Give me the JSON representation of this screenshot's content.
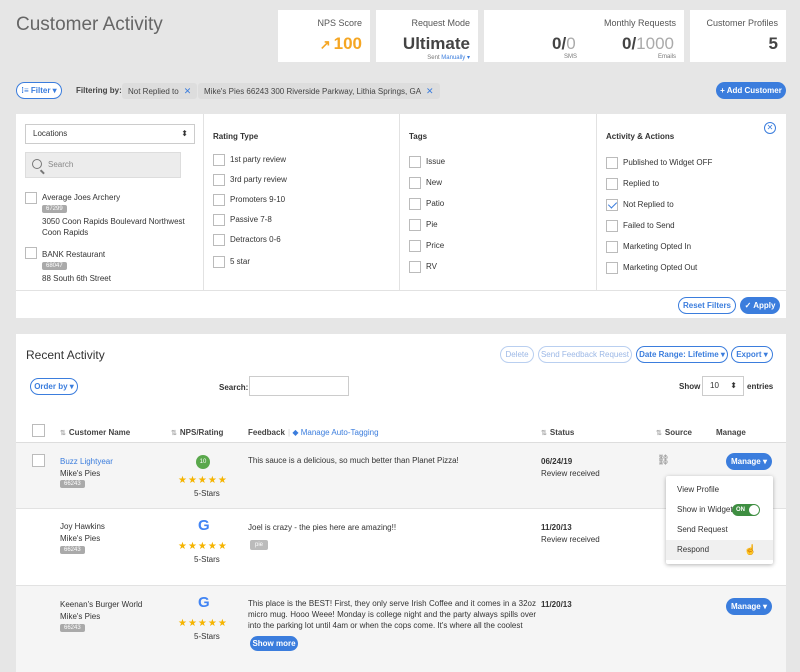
{
  "page_title": "Customer Activity",
  "stats": {
    "nps": {
      "label": "NPS Score",
      "value": "100"
    },
    "request_mode": {
      "label": "Request Mode",
      "value": "Ultimate",
      "sub_prefix": "Sent",
      "sub_link": "Manually"
    },
    "monthly": {
      "label": "Monthly Requests",
      "sms_value": "0/",
      "sms_limit": "0",
      "sms_label": "SMS",
      "email_value": "0/",
      "email_limit": "1000",
      "email_label": "Emails"
    },
    "profiles": {
      "label": "Customer Profiles",
      "value": "5"
    }
  },
  "filterbar": {
    "filter_btn": "Filter",
    "filtering_by": "Filtering by:",
    "chips": [
      "Not Replied to",
      "Mike's Pies 66243 300 Riverside Parkway, Lithia Springs, GA"
    ],
    "add_customer": "+ Add Customer"
  },
  "filters": {
    "locations_select": "Locations",
    "search_placeholder": "Search",
    "locations": [
      {
        "name": "Average Joes Archery",
        "id": "67299",
        "address": "3050 Coon Rapids Boulevard Northwest",
        "city": "Coon Rapids"
      },
      {
        "name": "BANK Restaurant",
        "id": "68047",
        "address": "88 South 6th Street",
        "city": ""
      }
    ],
    "rating_title": "Rating Type",
    "ratings": [
      "1st party review",
      "3rd party review",
      "Promoters 9-10",
      "Passive 7-8",
      "Detractors 0-6",
      "5 star"
    ],
    "tags_title": "Tags",
    "tags": [
      "Issue",
      "New",
      "Patio",
      "Pie",
      "Price",
      "RV"
    ],
    "activity_title": "Activity & Actions",
    "activities": [
      {
        "label": "Published to Widget OFF",
        "checked": false
      },
      {
        "label": "Replied to",
        "checked": false
      },
      {
        "label": "Not Replied to",
        "checked": true
      },
      {
        "label": "Failed to Send",
        "checked": false
      },
      {
        "label": "Marketing Opted In",
        "checked": false
      },
      {
        "label": "Marketing Opted Out",
        "checked": false
      }
    ],
    "reset": "Reset Filters",
    "apply": "Apply"
  },
  "recent": {
    "title": "Recent Activity",
    "delete": "Delete",
    "send_feedback": "Send Feedback Request",
    "date_range": "Date Range: Lifetime",
    "export": "Export",
    "order_by": "Order by",
    "search_label": "Search:",
    "show_label": "Show",
    "show_value": "10",
    "entries_label": "entries",
    "columns": {
      "name": "Customer Name",
      "nps": "NPS/Rating",
      "feedback": "Feedback",
      "auto_tag": "Manage Auto-Tagging",
      "status": "Status",
      "source": "Source",
      "manage": "Manage"
    },
    "rows": [
      {
        "name": "Buzz Lightyear",
        "location": "Mike's Pies",
        "loc_id": "66243",
        "nps": "10",
        "stars_label": "5-Stars",
        "feedback": "This sauce is a delicious, so much better than Planet Pizza!",
        "date": "06/24/19",
        "status": "Review received",
        "manage": "Manage"
      },
      {
        "name": "Joy Hawkins",
        "location": "Mike's Pies",
        "loc_id": "66243",
        "nps": "",
        "stars_label": "5-Stars",
        "feedback": "Joel is crazy - the pies here are amazing!!",
        "tag": "pie",
        "date": "11/20/13",
        "status": "Review received",
        "manage": ""
      },
      {
        "name": "Keenan's Burger World",
        "location": "Mike's Pies",
        "loc_id": "66243",
        "nps": "",
        "stars_label": "5-Stars",
        "feedback": "This place is the BEST! First, they only serve Irish Coffee and it comes in a 32oz micro mug. Hooo Weee! Monday is college night and the party always spills over into the parking lot until 4am or when the cops come. It's where all the coolest",
        "date": "11/20/13",
        "status": "",
        "manage": "Manage",
        "show_more": "Show more"
      }
    ],
    "dropdown": {
      "view_profile": "View Profile",
      "show_widget": "Show in Widget",
      "toggle": "ON",
      "send_request": "Send Request",
      "respond": "Respond"
    }
  },
  "colors": {
    "accent": "#3b7ddd",
    "nps_orange": "#f5a623",
    "star": "#f5b400",
    "nps_green": "#5aa84c"
  }
}
